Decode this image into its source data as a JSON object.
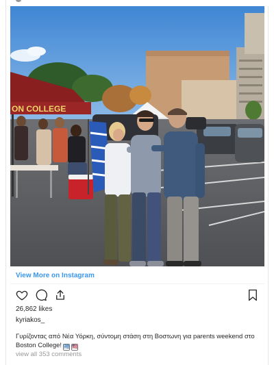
{
  "post": {
    "view_more_label": "View More on Instagram",
    "likes_text": "26,862 likes",
    "username": "kyriakos_",
    "caption_text": "Γυρίζοντας από Νέα Υόρκη, σύντομη στάση στη Βοστωνη για parents weekend στο Boston College!",
    "caption_emojis": [
      "🇬🇷",
      "🇺🇸"
    ],
    "view_comments_label": "view all 353 comments",
    "tent_banner_text": "ON COLLEGE"
  },
  "icons": {
    "like": "heart-icon",
    "comment": "comment-bubble-icon",
    "share": "share-icon",
    "save": "bookmark-icon"
  },
  "colors": {
    "link_blue": "#3897f0",
    "text_dark": "#262626",
    "text_muted": "#999999",
    "sky": "#4a8fd8",
    "maroon_tent": "#8a1f1f"
  }
}
